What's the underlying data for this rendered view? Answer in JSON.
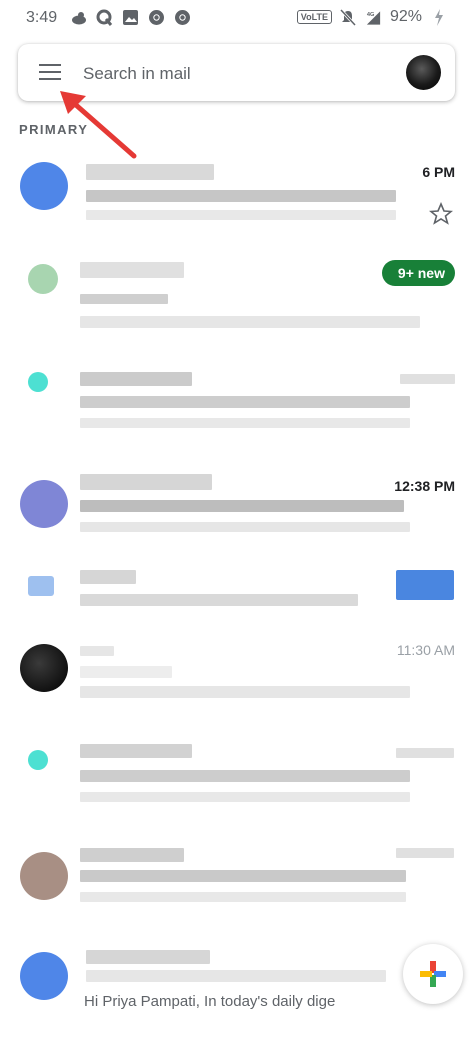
{
  "status_bar": {
    "time": "3:49",
    "network_badge": "VoLTE",
    "battery": "92%",
    "left_icons": [
      "weather-icon",
      "quora-icon",
      "gallery-icon",
      "chrome-icon",
      "chrome-icon"
    ],
    "right_icons": [
      "mute-icon",
      "signal-4g-icon",
      "charging-icon"
    ]
  },
  "search": {
    "placeholder": "Search in mail"
  },
  "section": {
    "label": "PRIMARY"
  },
  "emails": [
    {
      "time": "6 PM",
      "starred": false
    },
    {
      "badge": "9+ new"
    },
    {},
    {
      "time": "12:38 PM"
    },
    {},
    {
      "time": "11:30 AM"
    },
    {},
    {},
    {
      "snippet": "Hi Priya Pampati, In today's daily dige"
    }
  ],
  "colors": {
    "accent_green": "#188038",
    "arrow_red": "#e53935",
    "blue": "#1a73e8"
  }
}
